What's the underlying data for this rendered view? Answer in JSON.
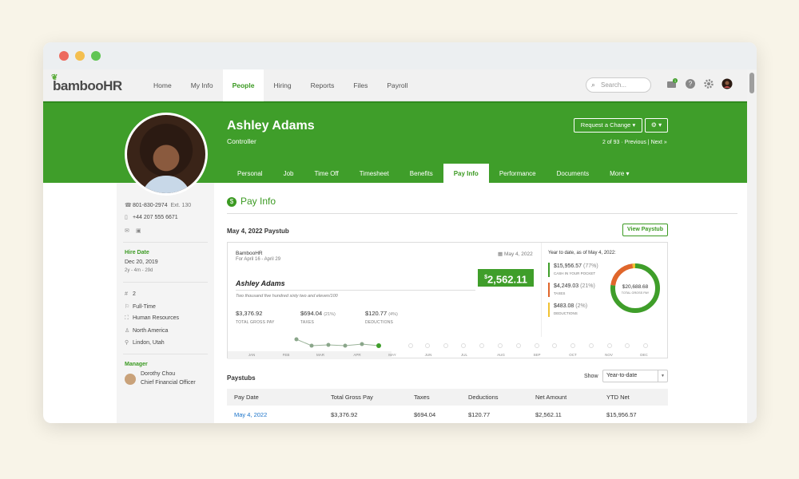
{
  "window": {
    "dots": [
      "#ed6a5e",
      "#f4bf4f",
      "#61c554"
    ]
  },
  "nav": {
    "logo": "bambooHR",
    "items": [
      "Home",
      "My Info",
      "People",
      "Hiring",
      "Reports",
      "Files",
      "Payroll"
    ],
    "active": "People",
    "search_placeholder": "Search...",
    "inbox_count": "1"
  },
  "profile": {
    "name": "Ashley Adams",
    "title": "Controller",
    "request_change": "Request a Change",
    "pager": "2 of 93 · Previous | Next »",
    "tabs": [
      "Personal",
      "Job",
      "Time Off",
      "Timesheet",
      "Benefits",
      "Pay Info",
      "Performance",
      "Documents",
      "More"
    ],
    "active_tab": "Pay Info"
  },
  "sidebar": {
    "work_phone": "801-830-2974",
    "ext": "Ext. 130",
    "mobile": "+44 207 555 6671",
    "hire_date_label": "Hire Date",
    "hire_date": "Dec 20, 2019",
    "tenure": "2y - 4m - 29d",
    "employee_number": "2",
    "employment_type": "Full-Time",
    "department": "Human Resources",
    "region": "North America",
    "location": "Lindon, Utah",
    "manager_label": "Manager",
    "manager_name": "Dorothy Chou",
    "manager_title": "Chief Financial Officer"
  },
  "pay": {
    "heading": "Pay Info",
    "paystub_title": "May 4, 2022 Paystub",
    "view_paystub": "View Paystub",
    "company": "BambooHR",
    "period": "For April 16 - April 29",
    "date": "May 4, 2022",
    "net_currency": "$",
    "net": "2,562.11",
    "employee": "Ashley Adams",
    "amount_words": "Two thousand five hundred sixty two and eleven/100",
    "gross": "$3,376.92",
    "gross_label": "TOTAL GROSS PAY",
    "taxes": "$694.04",
    "taxes_pct": "(21%)",
    "taxes_label": "TAXES",
    "deductions": "$120.77",
    "deductions_pct": "(4%)",
    "deductions_label": "DEDUCTIONS"
  },
  "ytd": {
    "heading": "Year to date, as of May 4, 2022:",
    "cash": "$15,956.57",
    "cash_pct": "(77%)",
    "cash_label": "CASH IN YOUR POCKET",
    "taxes": "$4,249.03",
    "taxes_pct": "(21%)",
    "taxes_label": "TAXES",
    "deductions": "$483.08",
    "deductions_pct": "(2%)",
    "deductions_label": "DEDUCTIONS",
    "total": "$20,688.68",
    "total_label": "TOTAL GROSS PAY",
    "colors": {
      "cash": "#3f9e2a",
      "taxes": "#e0662b",
      "deductions": "#f1c232"
    }
  },
  "timeline": {
    "months": [
      "JAN",
      "FEB",
      "MAR",
      "APR",
      "MAY",
      "JUN",
      "JUL",
      "AUG",
      "SEP",
      "OCT",
      "NOV",
      "DEC"
    ]
  },
  "paystubs": {
    "title": "Paystubs",
    "show_label": "Show",
    "show_value": "Year-to-date",
    "columns": [
      "Pay Date",
      "Total Gross Pay",
      "Taxes",
      "Deductions",
      "Net Amount",
      "YTD Net"
    ],
    "rows": [
      [
        "May 4, 2022",
        "$3,376.92",
        "$694.04",
        "$120.77",
        "$2,562.11",
        "$15,956.57"
      ]
    ]
  }
}
